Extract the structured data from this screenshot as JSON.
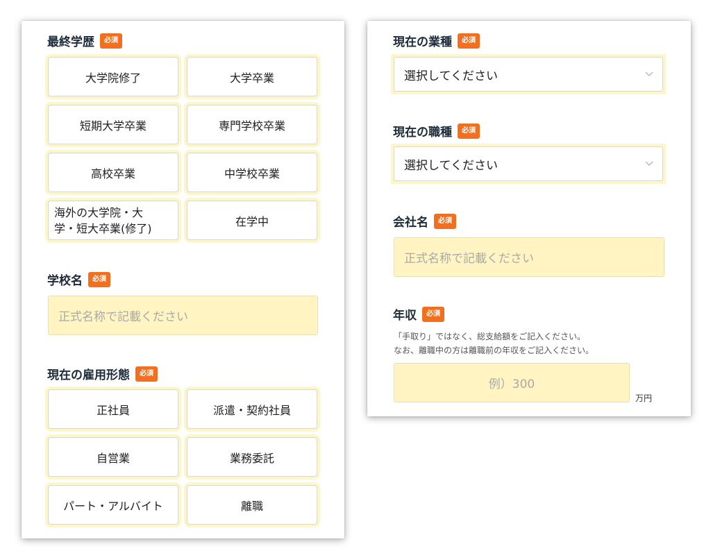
{
  "education": {
    "label": "最終学歴",
    "required_badge": "必須",
    "options": [
      "大学院修了",
      "大学卒業",
      "短期大学卒業",
      "専門学校卒業",
      "高校卒業",
      "中学校卒業",
      "海外の大学院・大\n学・短大卒業(修了)",
      "在学中"
    ]
  },
  "school": {
    "label": "学校名",
    "required_badge": "必須",
    "placeholder": "正式名称で記載ください"
  },
  "employment": {
    "label": "現在の雇用形態",
    "required_badge": "必須",
    "options": [
      "正社員",
      "派遣・契約社員",
      "自営業",
      "業務委託",
      "パート・アルバイト",
      "離職"
    ]
  },
  "industry": {
    "label": "現在の業種",
    "required_badge": "必須",
    "selected": "選択してください"
  },
  "occupation": {
    "label": "現在の職種",
    "required_badge": "必須",
    "selected": "選択してください"
  },
  "company": {
    "label": "会社名",
    "required_badge": "必須",
    "placeholder": "正式名称で記載ください"
  },
  "income": {
    "label": "年収",
    "required_badge": "必須",
    "note_line1": "「手取り」ではなく、総支給額をご記入ください。",
    "note_line2": "なお、離職中の方は離職前の年収をご記入ください。",
    "placeholder": "例）300",
    "unit": "万円"
  },
  "colors": {
    "badge": "#f26f1f",
    "input_bg": "#fff4c2",
    "option_glow": "#fdf6c8",
    "label_text": "#1d2b3a"
  }
}
